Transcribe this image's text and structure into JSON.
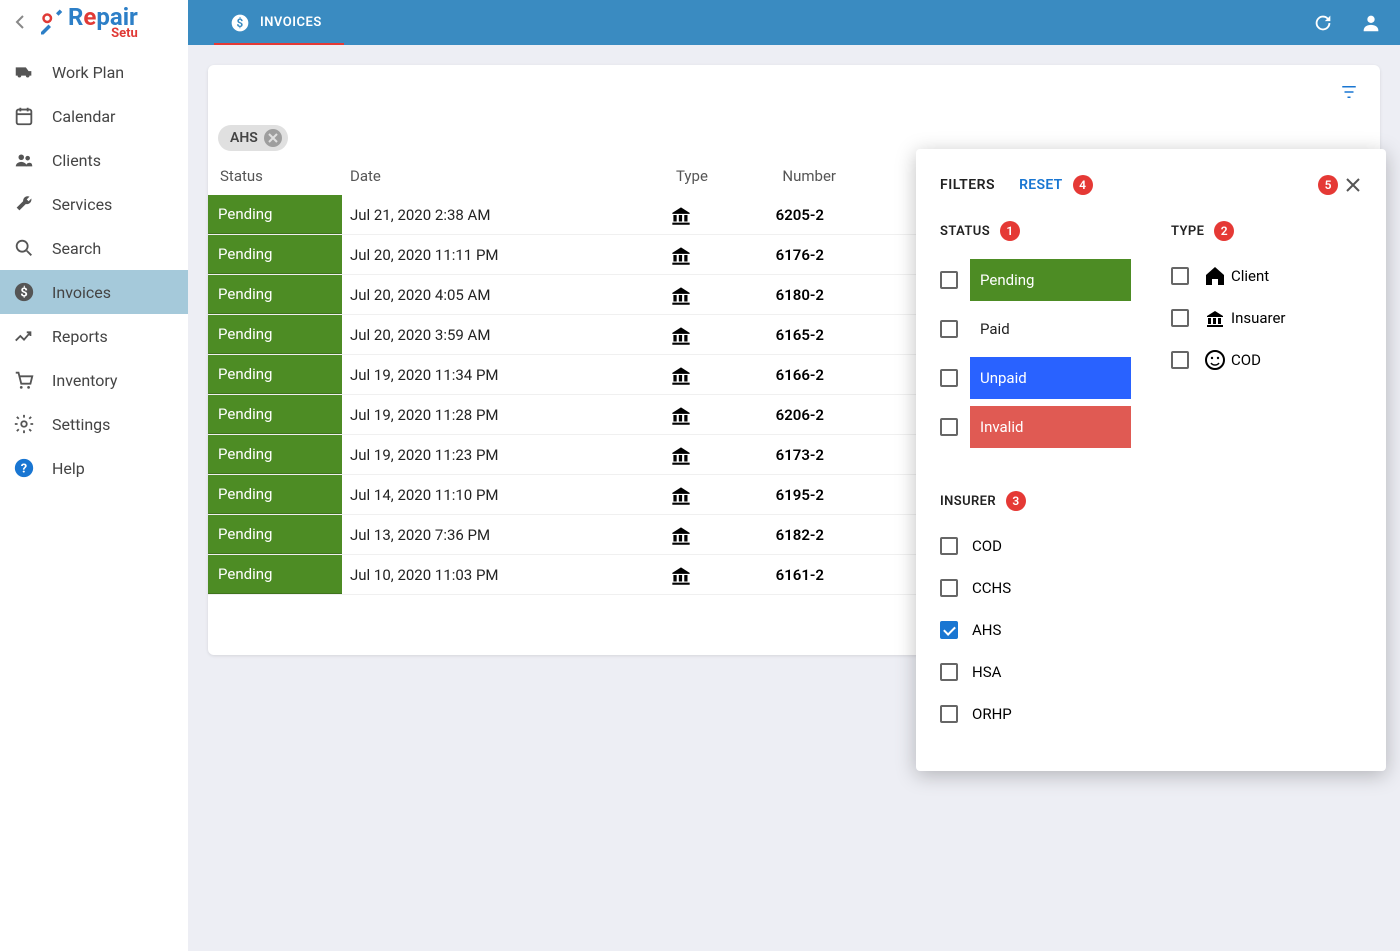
{
  "brand": {
    "line1_parts": [
      "R",
      "e",
      "p",
      "a",
      "i",
      "r"
    ],
    "line2": "Setu"
  },
  "sidebar": {
    "items": [
      {
        "label": "Work Plan",
        "icon": "van"
      },
      {
        "label": "Calendar",
        "icon": "calendar"
      },
      {
        "label": "Clients",
        "icon": "people"
      },
      {
        "label": "Services",
        "icon": "wrench"
      },
      {
        "label": "Search",
        "icon": "search"
      },
      {
        "label": "Invoices",
        "icon": "dollar",
        "active": true
      },
      {
        "label": "Reports",
        "icon": "trend"
      },
      {
        "label": "Inventory",
        "icon": "cart"
      },
      {
        "label": "Settings",
        "icon": "gear"
      },
      {
        "label": "Help",
        "icon": "help"
      }
    ]
  },
  "tab": {
    "label": "INVOICES"
  },
  "chip": {
    "label": "AHS"
  },
  "table": {
    "headers": {
      "status": "Status",
      "date": "Date",
      "type": "Type",
      "number": "Number"
    },
    "rows": [
      {
        "status": "Pending",
        "date": "Jul 21, 2020 2:38 AM",
        "number": "6205-2"
      },
      {
        "status": "Pending",
        "date": "Jul 20, 2020 11:11 PM",
        "number": "6176-2"
      },
      {
        "status": "Pending",
        "date": "Jul 20, 2020 4:05 AM",
        "number": "6180-2"
      },
      {
        "status": "Pending",
        "date": "Jul 20, 2020 3:59 AM",
        "number": "6165-2"
      },
      {
        "status": "Pending",
        "date": "Jul 19, 2020 11:34 PM",
        "number": "6166-2"
      },
      {
        "status": "Pending",
        "date": "Jul 19, 2020 11:28 PM",
        "number": "6206-2"
      },
      {
        "status": "Pending",
        "date": "Jul 19, 2020 11:23 PM",
        "number": "6173-2"
      },
      {
        "status": "Pending",
        "date": "Jul 14, 2020 11:10 PM",
        "number": "6195-2"
      },
      {
        "status": "Pending",
        "date": "Jul 13, 2020 7:36 PM",
        "number": "6182-2"
      },
      {
        "status": "Pending",
        "date": "Jul 10, 2020 11:03 PM",
        "number": "6161-2"
      }
    ]
  },
  "filters": {
    "title": "FILTERS",
    "reset": "RESET",
    "sections": {
      "status": {
        "title": "STATUS",
        "badge": "1",
        "options": [
          {
            "label": "Pending",
            "class": "status-pending",
            "checked": false
          },
          {
            "label": "Paid",
            "class": "status-paid",
            "checked": false
          },
          {
            "label": "Unpaid",
            "class": "status-unpaid",
            "checked": false
          },
          {
            "label": "Invalid",
            "class": "status-invalid",
            "checked": false
          }
        ]
      },
      "type": {
        "title": "TYPE",
        "badge": "2",
        "options": [
          {
            "label": "Client",
            "icon": "home",
            "checked": false
          },
          {
            "label": "Insuarer",
            "icon": "bank",
            "checked": false
          },
          {
            "label": "COD",
            "icon": "face",
            "checked": false
          }
        ]
      },
      "insurer": {
        "title": "INSURER",
        "badge": "3",
        "options": [
          {
            "label": "COD",
            "checked": false
          },
          {
            "label": "CCHS",
            "checked": false
          },
          {
            "label": "AHS",
            "checked": true
          },
          {
            "label": "HSA",
            "checked": false
          },
          {
            "label": "ORHP",
            "checked": false
          }
        ]
      }
    },
    "reset_badge": "4",
    "close_badge": "5"
  }
}
